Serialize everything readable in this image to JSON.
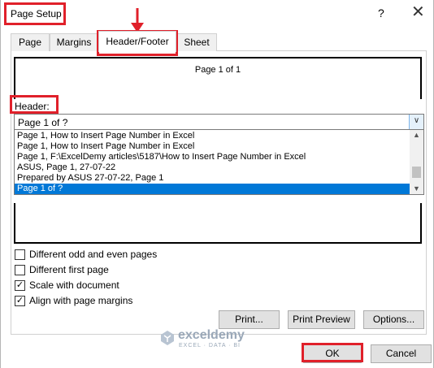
{
  "title": "Page Setup",
  "help": "?",
  "close": "✕",
  "tabs": [
    "Page",
    "Margins",
    "Header/Footer",
    "Sheet"
  ],
  "preview_text": "Page 1 of 1",
  "header_label": "Header:",
  "header_value": "Page 1 of ?",
  "header_options": [
    "Page 1, How to Insert Page Number in Excel",
    "Page 1, How to Insert Page Number in Excel",
    "Page 1, F:\\ExcelDemy articles\\5187\\How to Insert Page Number in Excel",
    "ASUS, Page 1, 27-07-22",
    "Prepared by ASUS 27-07-22, Page 1",
    "Page 1 of ?"
  ],
  "checkboxes": [
    {
      "label": "Different odd and even pages",
      "checked": false
    },
    {
      "label": "Different first page",
      "checked": false
    },
    {
      "label": "Scale with document",
      "checked": true
    },
    {
      "label": "Align with page margins",
      "checked": true
    }
  ],
  "buttons": {
    "print": "Print...",
    "print_preview": "Print Preview",
    "options": "Options...",
    "ok": "OK",
    "cancel": "Cancel"
  },
  "watermark": {
    "name": "exceldemy",
    "tagline": "EXCEL · DATA · BI"
  },
  "colors": {
    "highlight": "#e0202a",
    "selection": "#0078d7"
  }
}
